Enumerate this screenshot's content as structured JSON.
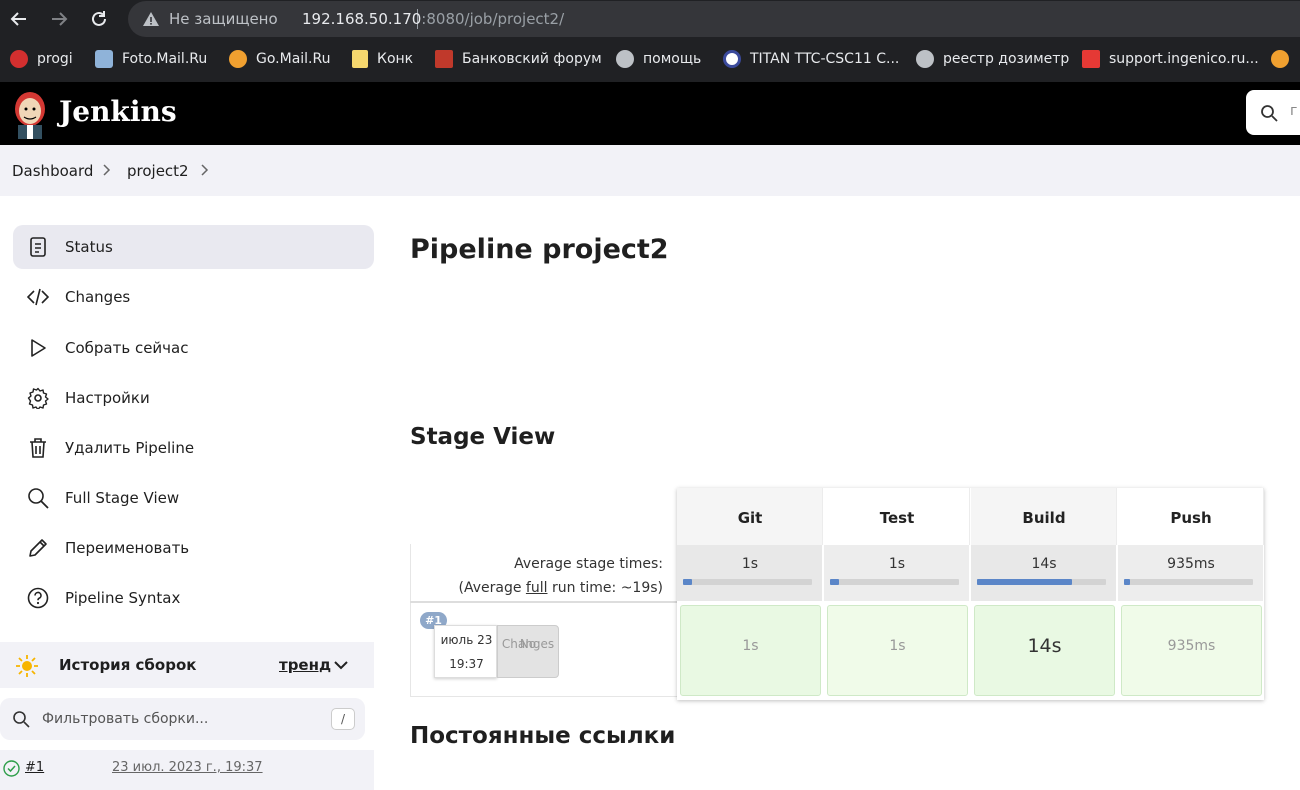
{
  "browser": {
    "insecure_label": "Не защищено",
    "url_host": "192.168.50.170",
    "url_rest": ":8080/job/project2/",
    "bookmarks": [
      {
        "label": "progi",
        "color": "#d32f2f"
      },
      {
        "label": "Foto.Mail.Ru",
        "color": "#8fb3d9"
      },
      {
        "label": "Go.Mail.Ru",
        "color": "#f0a030"
      },
      {
        "label": "Конк",
        "color": "#f5d76e"
      },
      {
        "label": "Банковский форум",
        "color": "#c0392b"
      },
      {
        "label": "помощь",
        "color": "#bdc1c6"
      },
      {
        "label": "TITAN TTC-CSC11 C...",
        "color": "#ffffff"
      },
      {
        "label": "реестр дозиметр",
        "color": "#bdc1c6"
      },
      {
        "label": "support.ingenico.ru...",
        "color": "#e53935"
      }
    ]
  },
  "jenkins": {
    "brand": "Jenkins",
    "search_placeholder": "г"
  },
  "breadcrumb": [
    "Dashboard",
    "project2"
  ],
  "sidebar": {
    "items": [
      {
        "label": "Status",
        "icon": "status-icon"
      },
      {
        "label": "Changes",
        "icon": "code-icon"
      },
      {
        "label": "Собрать сейчас",
        "icon": "play-icon"
      },
      {
        "label": "Настройки",
        "icon": "gear-icon"
      },
      {
        "label": "Удалить Pipeline",
        "icon": "trash-icon"
      },
      {
        "label": "Full Stage View",
        "icon": "search-icon"
      },
      {
        "label": "Переименовать",
        "icon": "pencil-icon"
      },
      {
        "label": "Pipeline Syntax",
        "icon": "help-icon"
      }
    ],
    "history": {
      "title": "История сборок",
      "trend": "тренд",
      "filter_placeholder": "Фильтровать сборки...",
      "filter_key": "/",
      "builds": [
        {
          "number": "#1",
          "date": "23 июл. 2023 г., 19:37"
        }
      ]
    }
  },
  "main": {
    "title": "Pipeline project2",
    "stage_view_title": "Stage View",
    "permalinks_title": "Постоянные ссылки",
    "avg_label": "Average stage times:",
    "avg_run_prefix": "(Average ",
    "avg_run_link": "full",
    "avg_run_suffix": " run time: ~19s)",
    "run": {
      "badge": "#1",
      "date": "июль 23",
      "time": "19:37",
      "no_changes_1": "No",
      "no_changes_2": "Changes"
    },
    "stages": [
      {
        "name": "Git",
        "avg": "1s",
        "run": "1s",
        "fraction": 0.07
      },
      {
        "name": "Test",
        "avg": "1s",
        "run": "1s",
        "fraction": 0.07
      },
      {
        "name": "Build",
        "avg": "14s",
        "run": "14s",
        "fraction": 0.74
      },
      {
        "name": "Push",
        "avg": "935ms",
        "run": "935ms",
        "fraction": 0.05
      }
    ]
  }
}
